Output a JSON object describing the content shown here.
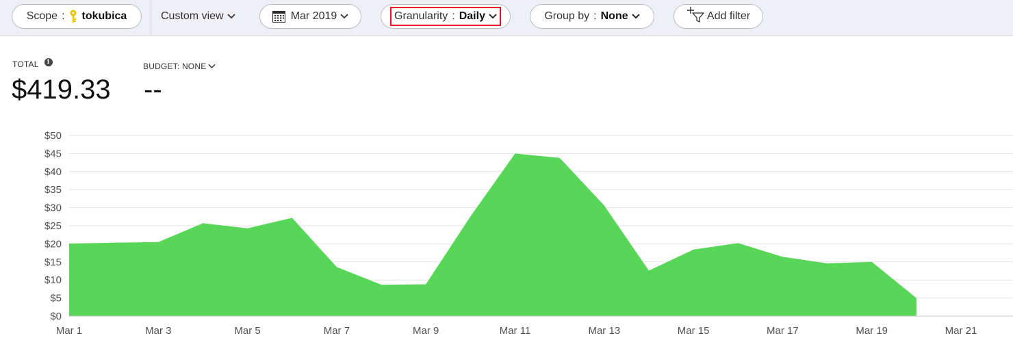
{
  "toolbar": {
    "scope_label": "Scope",
    "scope_separator": ":",
    "scope_value": "tokubica",
    "custom_view_label": "Custom view",
    "date_label": "Mar 2019",
    "granularity_label": "Granularity",
    "granularity_separator": ":",
    "granularity_value": "Daily",
    "group_by_label": "Group by",
    "group_by_separator": ":",
    "group_by_value": "None",
    "add_filter_label": "Add filter",
    "highlight_color": "#e81123",
    "icons": [
      "key-icon",
      "chevron-down-icon",
      "calendar-icon",
      "add-filter-icon"
    ]
  },
  "summary": {
    "total_label": "TOTAL",
    "total_value": "$419.33",
    "budget_label": "BUDGET: NONE",
    "budget_value": "--"
  },
  "chart_data": {
    "type": "area",
    "x": [
      "Mar 1",
      "Mar 2",
      "Mar 3",
      "Mar 4",
      "Mar 5",
      "Mar 6",
      "Mar 7",
      "Mar 8",
      "Mar 9",
      "Mar 10",
      "Mar 11",
      "Mar 12",
      "Mar 13",
      "Mar 14",
      "Mar 15",
      "Mar 16",
      "Mar 17",
      "Mar 18",
      "Mar 19",
      "Mar 20"
    ],
    "values": [
      20.1,
      20.3,
      20.5,
      25.7,
      24.3,
      27.2,
      13.6,
      8.7,
      8.8,
      27.6,
      45.0,
      43.8,
      30.6,
      12.6,
      18.4,
      20.2,
      16.4,
      14.6,
      15.0,
      5.0
    ],
    "x_tick_labels": [
      "Mar 1",
      "Mar 3",
      "Mar 5",
      "Mar 7",
      "Mar 9",
      "Mar 11",
      "Mar 13",
      "Mar 15",
      "Mar 17",
      "Mar 19",
      "Mar 21"
    ],
    "y_tick_labels": [
      "$0",
      "$5",
      "$10",
      "$15",
      "$20",
      "$25",
      "$30",
      "$35",
      "$40",
      "$45",
      "$50"
    ],
    "ylim": [
      0,
      50
    ],
    "xlim_days": [
      1,
      22
    ],
    "grid": true,
    "fill_color": "#57d658",
    "title": "",
    "xlabel": "",
    "ylabel": ""
  }
}
